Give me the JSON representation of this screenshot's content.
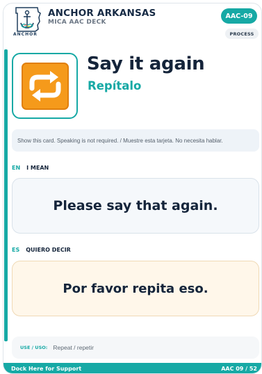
{
  "header": {
    "logo_text": "ANCHOR",
    "org_name": "ANCHOR ARKANSAS",
    "deck_name": "MICA AAC DECK",
    "card_id": "AAC-09",
    "category": "PROCESS"
  },
  "hero": {
    "icon": "repeat-arrows-icon",
    "title_en": "Say it again",
    "title_es": "Repítalo"
  },
  "instruction": "Show this card. Speaking is not required. / Muestre esta tarjeta. No necesita hablar.",
  "english": {
    "code": "EN",
    "label": "I MEAN",
    "phrase": "Please say that again."
  },
  "spanish": {
    "code": "ES",
    "label": "QUIERO DECIR",
    "phrase": "Por favor repita eso."
  },
  "use": {
    "label": "USE / USO:",
    "value": "Repeat / repetir"
  },
  "footer": {
    "left": "Dock Here for Support",
    "right": "AAC 09 / 52"
  },
  "colors": {
    "accent": "#16a9a5",
    "navy": "#14243a",
    "icon_orange": "#f59a1b"
  }
}
